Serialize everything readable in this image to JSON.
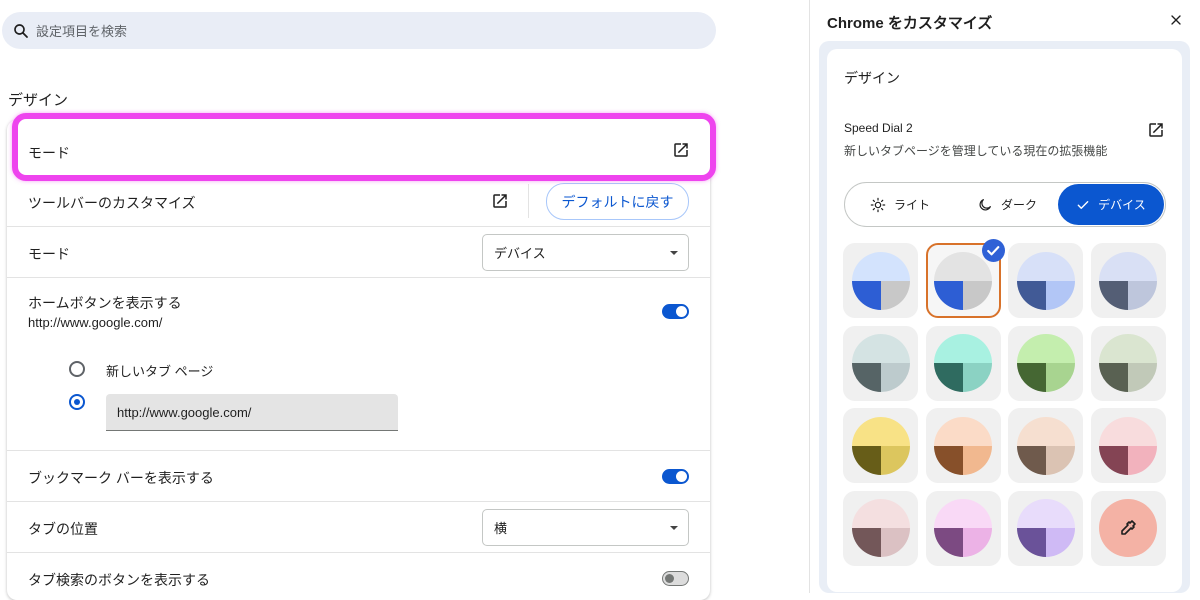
{
  "search": {
    "placeholder": "設定項目を検索",
    "icon": "search-icon"
  },
  "settings": {
    "section_title": "デザイン",
    "highlight_label": "モード",
    "toolbar_customize_label": "ツールバーのカスタマイズ",
    "reset_button_label": "デフォルトに戻す",
    "mode_label": "モード",
    "mode_value": "デバイス",
    "home_button_label": "ホームボタンを表示する",
    "home_button_url": "http://www.google.com/",
    "home_button_on": true,
    "radio_new_tab_label": "新しいタブ ページ",
    "radio_url_value": "http://www.google.com/",
    "bookmark_bar_label": "ブックマーク バーを表示する",
    "bookmark_bar_on": true,
    "tab_position_label": "タブの位置",
    "tab_position_value": "横",
    "tab_search_label": "タブ検索のボタンを表示する",
    "tab_search_on": false
  },
  "customize_panel": {
    "title": "Chrome をカスタマイズ",
    "section_title": "デザイン",
    "extension_name": "Speed Dial 2",
    "extension_desc": "新しいタブページを管理している現在の拡張機能",
    "modes": [
      {
        "label": "ライト",
        "icon": "sun-icon",
        "active": false
      },
      {
        "label": "ダーク",
        "icon": "moon-icon",
        "active": false
      },
      {
        "label": "デバイス",
        "icon": "check-icon",
        "active": true
      }
    ],
    "swatches": [
      {
        "top": "#d3e3fd",
        "left": "#2d5ed4",
        "right": "#c8c8c8",
        "selected": false
      },
      {
        "top": "#e3e3e3",
        "left": "#2d5ed4",
        "right": "#c8c8c8",
        "selected": true
      },
      {
        "top": "#d7e0f8",
        "left": "#415a96",
        "right": "#b2c6f6",
        "selected": false
      },
      {
        "top": "#d9e0f5",
        "left": "#545e75",
        "right": "#bec6dc",
        "selected": false
      },
      {
        "top": "#d4e3e3",
        "left": "#566466",
        "right": "#bdcbcd",
        "selected": false
      },
      {
        "top": "#a8f1e1",
        "left": "#2f6b60",
        "right": "#8bd2c3",
        "selected": false
      },
      {
        "top": "#c4eeae",
        "left": "#456733",
        "right": "#a8d490",
        "selected": false
      },
      {
        "top": "#dae5d0",
        "left": "#596152",
        "right": "#c1c9b8",
        "selected": false
      },
      {
        "top": "#f8e286",
        "left": "#675d18",
        "right": "#dcc65e",
        "selected": false
      },
      {
        "top": "#fbdbc7",
        "left": "#87502a",
        "right": "#f1b88f",
        "selected": false
      },
      {
        "top": "#f6dfd0",
        "left": "#6f5a4c",
        "right": "#dbc3b3",
        "selected": false
      },
      {
        "top": "#f8dcdd",
        "left": "#844454",
        "right": "#f2b2bd",
        "selected": false
      },
      {
        "top": "#f4dfe0",
        "left": "#735759",
        "right": "#dbc1c3",
        "selected": false
      },
      {
        "top": "#f9d9f6",
        "left": "#7c4a82",
        "right": "#ecb2e6",
        "selected": false
      },
      {
        "top": "#e8dcfb",
        "left": "#6a5299",
        "right": "#cfbaf5",
        "selected": false
      },
      {
        "custom": true,
        "color": "#f4b2a5",
        "icon": "eyedropper-icon"
      }
    ]
  },
  "colors": {
    "accent": "#0b57d0",
    "highlight": "#ee44ee",
    "selected_border": "#d8722a"
  }
}
